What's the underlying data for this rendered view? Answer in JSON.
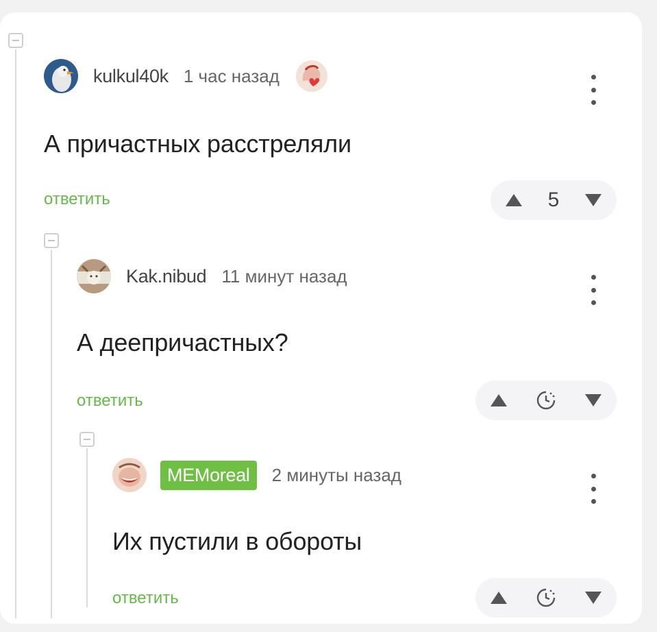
{
  "comments": [
    {
      "username": "kulkul40k",
      "timestamp": "1 час назад",
      "text": "А причастных расстреляли",
      "reply_label": "ответить",
      "score": "5",
      "score_hidden": false,
      "badge_icon": "heart-avatar-badge"
    },
    {
      "username": "Kak.nibud",
      "timestamp": "11 минут назад",
      "text": "А деепричастных?",
      "reply_label": "ответить",
      "score_hidden": true,
      "score_icon": "clock-icon"
    },
    {
      "username": "MEMoreal",
      "username_style": "tag",
      "tag_color": "#6fbf45",
      "timestamp": "2 минуты назад",
      "text": "Их пустили в обороты",
      "reply_label": "ответить",
      "score_hidden": true,
      "score_icon": "clock-icon"
    }
  ],
  "colors": {
    "reply_link": "#67b84a",
    "vote_bg": "#f4f4f6"
  }
}
